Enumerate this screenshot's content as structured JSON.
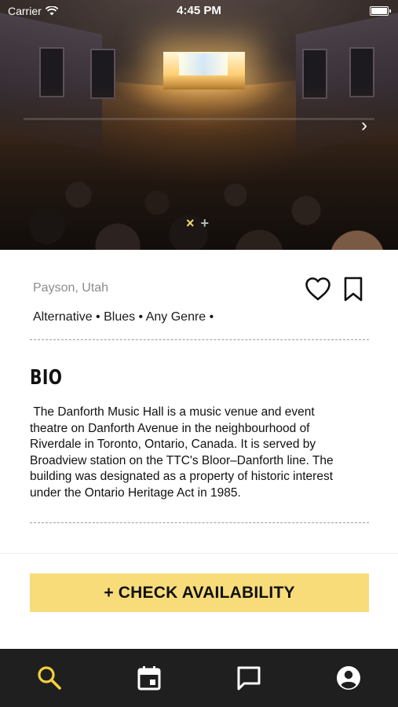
{
  "status_bar": {
    "carrier": "Carrier",
    "time": "4:45 PM"
  },
  "hero": {
    "carousel_indicators": [
      "×",
      "+"
    ],
    "next_icon": "chevron-right-icon"
  },
  "venue": {
    "location": "Payson, Utah",
    "genres": "Alternative • Blues • Any Genre •"
  },
  "bio": {
    "title": "BIO",
    "text": " The Danforth Music Hall is a music venue and event\ntheatre on Danforth Avenue in the neighbourhood of\nRiverdale in Toronto, Ontario, Canada. It is served by\nBroadview station on the TTC's Bloor–Danforth line. The\nbuilding was designated as a property of historic interest\nunder the Ontario Heritage Act in 1985."
  },
  "actions": {
    "check_availability": "+ CHECK AVAILABILITY"
  },
  "tabbar": {
    "tabs": [
      {
        "icon": "search-icon",
        "active": true
      },
      {
        "icon": "calendar-icon",
        "active": false
      },
      {
        "icon": "chat-icon",
        "active": false
      },
      {
        "icon": "profile-icon",
        "active": false
      }
    ]
  },
  "colors": {
    "accent": "#f8dc7a",
    "tab_active": "#f5cf3d",
    "tab_inactive": "#ffffff",
    "tabbar_bg": "#1f1f1f"
  }
}
